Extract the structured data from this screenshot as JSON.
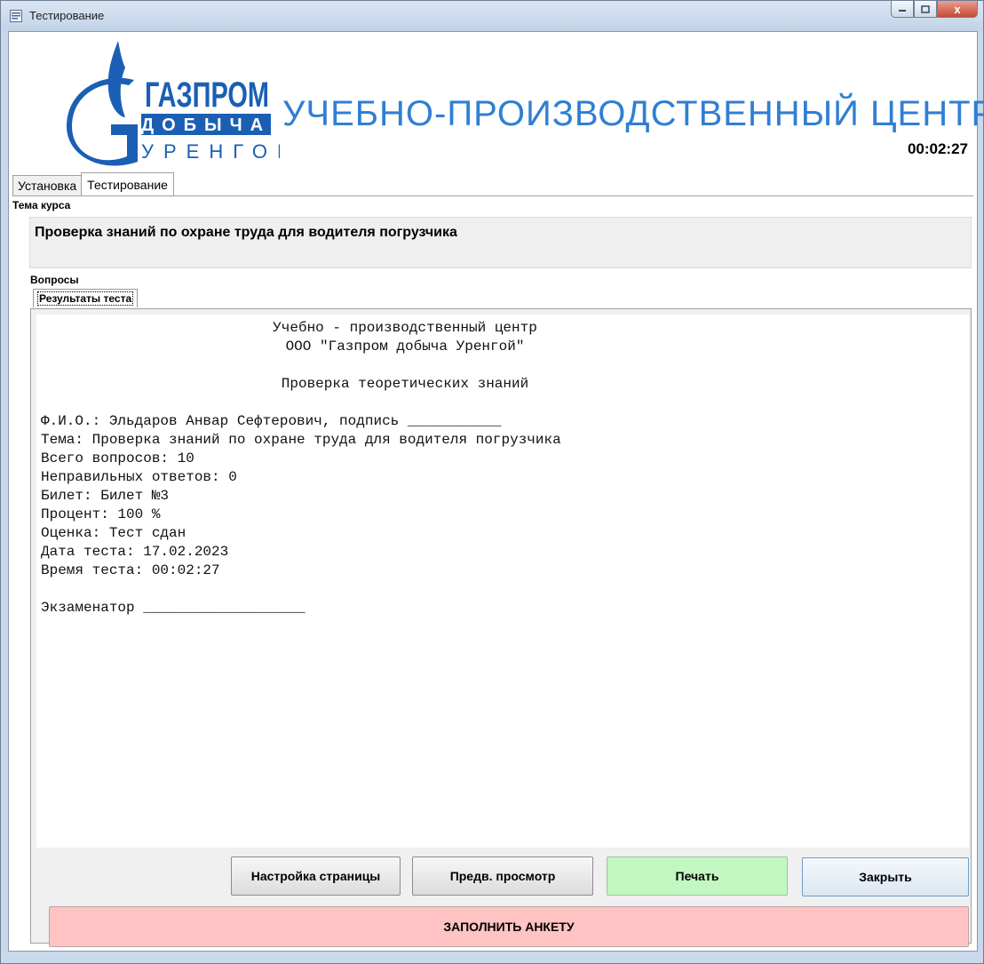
{
  "window": {
    "title": "Тестирование",
    "close_glyph": "x"
  },
  "header": {
    "logo_lines": [
      "ГАЗПРОМ",
      "ДОБЫЧА",
      "УРЕНГОЙ"
    ],
    "banner_title": "УЧЕБНО-ПРОИЗВОДСТВЕННЫЙ ЦЕНТР",
    "timer": "00:02:27",
    "brand_color": "#1a5fb4",
    "banner_color": "#2f7fd3"
  },
  "tabs": [
    {
      "label": "Установка",
      "active": false
    },
    {
      "label": "Тестирование",
      "active": true
    }
  ],
  "course": {
    "label": "Тема курса",
    "value": "Проверка знаний по охране труда для водителя погрузчика"
  },
  "questions": {
    "label": "Вопросы",
    "subtab": "Результаты теста"
  },
  "report": {
    "center_lines": [
      "Учебно - производственный центр",
      "ООО \"Газпром добыча Уренгой\"",
      "Проверка теоретических знаний"
    ],
    "lines": [
      "Ф.И.О.: Эльдаров Анвар Сефтерович, подпись ___________",
      "Тема: Проверка знаний по охране труда для водителя погрузчика",
      "Всего вопросов: 10",
      "Неправильных ответов: 0",
      "Билет: Билет №3",
      "Процент: 100 %",
      "Оценка: Тест сдан",
      "Дата теста: 17.02.2023",
      "Время теста: 00:02:27"
    ],
    "examiner": "Экзаменатор ___________________"
  },
  "buttons": {
    "page_setup": "Настройка страницы",
    "preview": "Предв. просмотр",
    "print": "Печать",
    "close": "Закрыть",
    "survey": "ЗАПОЛНИТЬ АНКЕТУ"
  }
}
